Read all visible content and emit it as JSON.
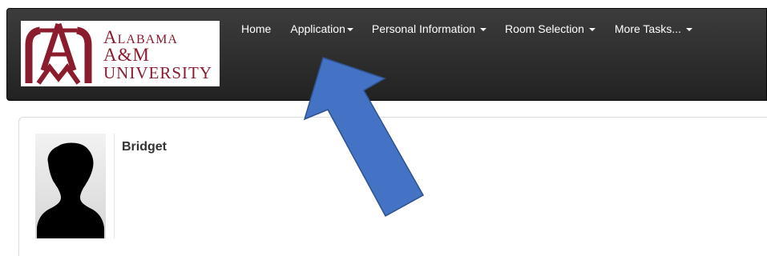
{
  "logo": {
    "line1": "Alabama",
    "line2": "A&M",
    "line3": "University",
    "monogram": "AM",
    "color": "#8a1c2e"
  },
  "nav": {
    "home": "Home",
    "application": "Application",
    "personal_information": "Personal Information",
    "room_selection": "Room Selection",
    "more_tasks": "More Tasks..."
  },
  "profile": {
    "name": "Bridget",
    "avatar_icon": "person-silhouette-icon"
  },
  "annotation": {
    "arrow_color": "#4472c4",
    "arrow_icon": "pointer-arrow-icon"
  },
  "colors": {
    "navbar": "#222222",
    "text_dark": "#333333"
  }
}
